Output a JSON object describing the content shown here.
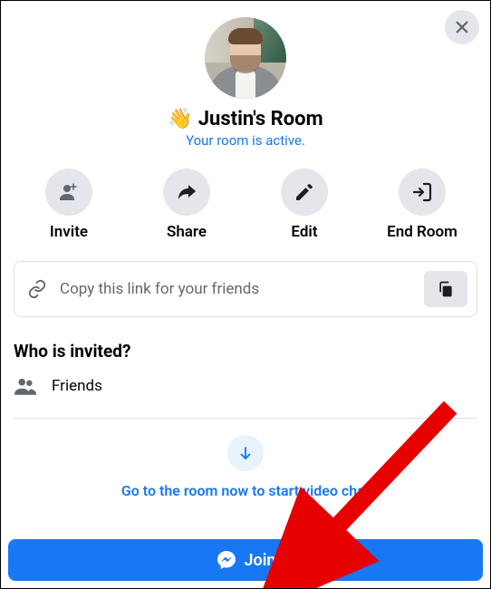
{
  "header": {
    "title": "Justin's Room",
    "subtitle": "Your room is active."
  },
  "actions": {
    "invite": "Invite",
    "share": "Share",
    "edit": "Edit",
    "end": "End Room"
  },
  "link_box": {
    "placeholder": "Copy this link for your friends"
  },
  "invited": {
    "heading": "Who is invited?",
    "scope": "Friends"
  },
  "goto": {
    "text": "Go to the room now to start video chat"
  },
  "join": {
    "label": "Join"
  },
  "colors": {
    "primary": "#1877f2",
    "circle_bg": "#e4e6eb"
  }
}
